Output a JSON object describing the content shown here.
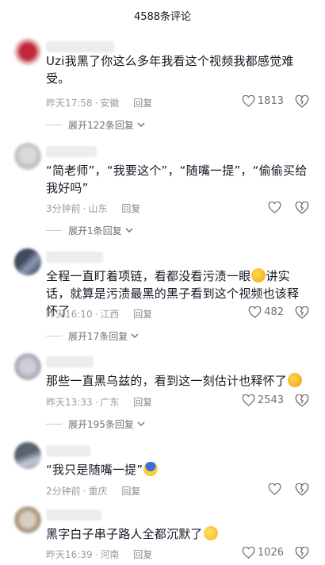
{
  "header": {
    "title": "4588条评论"
  },
  "colors": {
    "meta": "#9a9ba0",
    "text": "#161823",
    "accent_emoji": "#f6c433"
  },
  "comments": [
    {
      "text": "Uzi我黑了你这么多年我看这个视频我都感觉难受。",
      "time": "昨天17:58",
      "location": "安徽",
      "reply": "回复",
      "likes": "1813",
      "expand": "展开122条回复"
    },
    {
      "text": "“简老师”，“我要这个”，“随嘴一提”，“偷偷买给我好吗”",
      "time": "3分钟前",
      "location": "山东",
      "reply": "回复",
      "likes": "",
      "expand": "展开1条回复"
    },
    {
      "text": "全程一直盯着项链，看都没看污渍一眼",
      "text2": "讲实话，就算是污渍最黑的黑子看到这个视频也该释怀了",
      "emoji": "rolling-laughing-emoji",
      "time": "昨天16:10",
      "location": "江西",
      "reply": "回复",
      "likes": "482",
      "expand": "展开17条回复"
    },
    {
      "text": "那些一直黑乌兹的，看到这一刻估计也释怀了",
      "emoji": "crying-laughing-emoji",
      "time": "昨天13:33",
      "location": "广东",
      "reply": "回复",
      "likes": "2543",
      "expand": "展开195条回复"
    },
    {
      "text": "“我只是随嘴一提”",
      "emoji": "fearful-emoji",
      "time": "2分钟前",
      "location": "重庆",
      "reply": "回复",
      "likes": ""
    },
    {
      "text": "黑字白子串子路人全都沉默了",
      "emoji": "smiling-emoji",
      "time": "昨天16:39",
      "location": "河南",
      "reply": "回复",
      "likes": "1026"
    }
  ]
}
